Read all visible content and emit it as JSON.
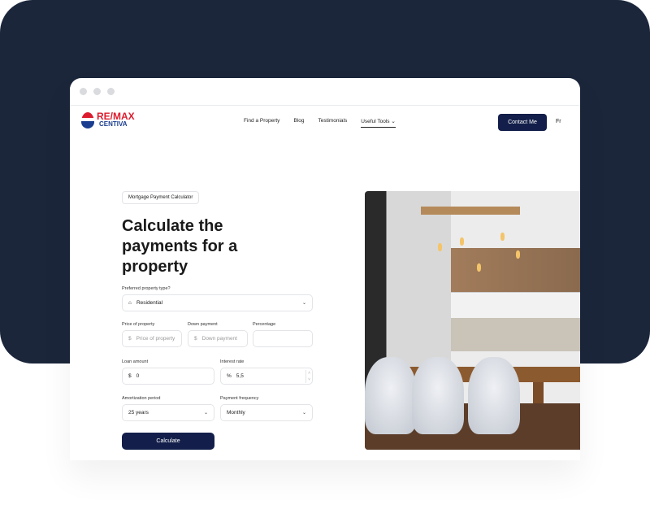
{
  "brand": {
    "line1": "RE/MAX",
    "line2": "CENTIVA"
  },
  "nav": {
    "links": [
      "Find a Property",
      "Blog",
      "Testimonials",
      "Useful Tools"
    ],
    "active": "Useful Tools",
    "contact": "Contact Me",
    "language": "Fr"
  },
  "hero": {
    "badge": "Mortgage Payment Calculator",
    "title": "Calculate the payments for a property"
  },
  "form": {
    "property_type": {
      "label": "Preferred property type?",
      "value": "Residential",
      "icon": "house-icon"
    },
    "price": {
      "label": "Price of property",
      "prefix": "$",
      "placeholder": "Price of property"
    },
    "down": {
      "label": "Down payment",
      "prefix": "$",
      "placeholder": "Down payment"
    },
    "percentage": {
      "label": "Percentage",
      "value": ""
    },
    "loan": {
      "label": "Loan amount",
      "prefix": "$",
      "value": "0"
    },
    "rate": {
      "label": "Interest rate",
      "prefix": "%",
      "value": "5,5"
    },
    "amortization": {
      "label": "Amortization period",
      "value": "25 years"
    },
    "frequency": {
      "label": "Payment frequency",
      "value": "Monthly"
    },
    "submit": "Calculate"
  },
  "colors": {
    "navy": "#1b263b",
    "button": "#131f4a",
    "brand_red": "#dc1c2e",
    "brand_blue": "#1a3d8f"
  }
}
